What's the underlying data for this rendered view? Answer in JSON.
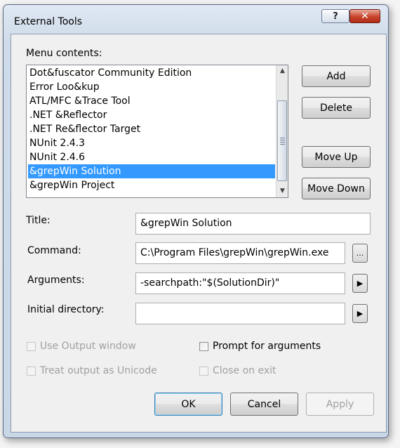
{
  "window": {
    "title": "External Tools",
    "help_glyph": "?",
    "close_glyph": "✕"
  },
  "menu_contents": {
    "label": "Menu contents:",
    "items": [
      {
        "label": "Dot&fuscator Community Edition"
      },
      {
        "label": "Error Loo&kup"
      },
      {
        "label": "ATL/MFC &Trace Tool"
      },
      {
        "label": ".NET &Reflector"
      },
      {
        "label": ".NET Re&flector Target"
      },
      {
        "label": "NUnit 2.4.3"
      },
      {
        "label": "NUnit 2.4.6"
      },
      {
        "label": "&grepWin Solution"
      },
      {
        "label": "&grepWin Project"
      }
    ],
    "selected_index": 7
  },
  "side_buttons": {
    "add": "Add",
    "delete": "Delete",
    "move_up": "Move Up",
    "move_down": "Move Down"
  },
  "fields": {
    "title": {
      "label": "Title:",
      "value": "&grepWin Solution"
    },
    "command": {
      "label": "Command:",
      "value": "C:\\Program Files\\grepWin\\grepWin.exe",
      "browse_label": "..."
    },
    "arguments": {
      "label": "Arguments:",
      "value": "-searchpath:\"$(SolutionDir)\""
    },
    "initial_directory": {
      "label": "Initial directory:",
      "value": ""
    }
  },
  "options": {
    "use_output_window": {
      "label": "Use Output window",
      "checked": false,
      "enabled": false
    },
    "prompt_for_arguments": {
      "label": "Prompt for arguments",
      "checked": false,
      "enabled": true
    },
    "treat_output_unicode": {
      "label": "Treat output as Unicode",
      "checked": false,
      "enabled": false
    },
    "close_on_exit": {
      "label": "Close on exit",
      "checked": false,
      "enabled": false
    }
  },
  "footer": {
    "ok": "OK",
    "cancel": "Cancel",
    "apply": "Apply"
  },
  "icons": {
    "arrow_right": "▶",
    "scroll_up": "▲",
    "scroll_down": "▼"
  }
}
